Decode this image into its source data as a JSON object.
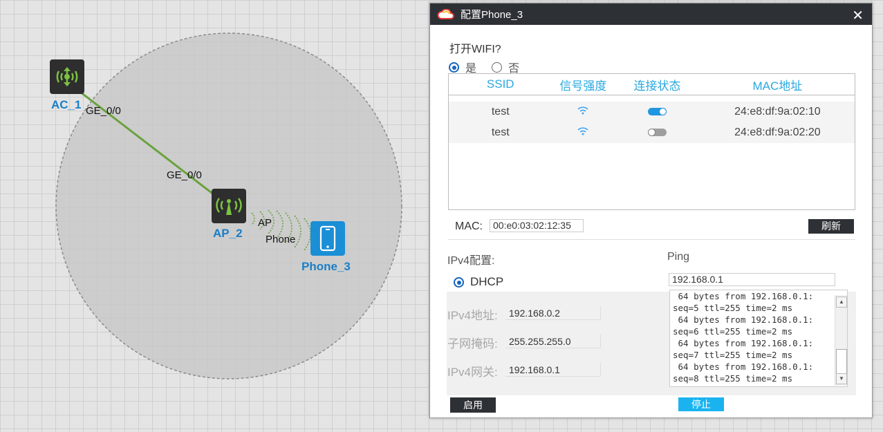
{
  "topology": {
    "nodes": [
      {
        "name": "AC_1",
        "icon": "access-controller-icon"
      },
      {
        "name": "AP_2",
        "icon": "access-point-icon"
      },
      {
        "name": "Phone_3",
        "icon": "phone-icon"
      }
    ],
    "link_labels": {
      "ac_port": "GE_0/0",
      "ap_port": "GE_0/0",
      "wifi_ap": "AP",
      "wifi_phone": "Phone"
    },
    "colors": {
      "link": "#6aa23c",
      "node_label": "#1a7fc7",
      "coverage": "#c8c8c8"
    }
  },
  "dialog": {
    "title": "配置Phone_3",
    "close": "✕",
    "wifi_question": "打开WIFI?",
    "wifi_yes": "是",
    "wifi_no": "否",
    "wifi_selected": "是",
    "table": {
      "headers": [
        "SSID",
        "信号强度",
        "连接状态",
        "MAC地址"
      ],
      "rows": [
        {
          "ssid": "test",
          "signal": "wifi-signal-icon",
          "connected": true,
          "mac": "24:e8:df:9a:02:10"
        },
        {
          "ssid": "test",
          "signal": "wifi-signal-icon",
          "connected": false,
          "mac": "24:e8:df:9a:02:20"
        }
      ]
    },
    "mac_label": "MAC:",
    "mac_value": "00:e0:03:02:12:35",
    "refresh_button": "刷新",
    "ipv4": {
      "section_label": "IPv4配置:",
      "dhcp_label": "DHCP",
      "address_label": "IPv4地址:",
      "address_value": "192.168.0.2",
      "mask_label": "子网掩码:",
      "mask_value": "255.255.255.0",
      "gateway_label": "IPv4网关:",
      "gateway_value": "192.168.0.1",
      "enable_button": "启用"
    },
    "ping": {
      "section_label": "Ping",
      "target_value": "192.168.0.1",
      "output": " 64 bytes from 192.168.0.1:\nseq=5 ttl=255 time=2 ms\n 64 bytes from 192.168.0.1:\nseq=6 ttl=255 time=2 ms\n 64 bytes from 192.168.0.1:\nseq=7 ttl=255 time=2 ms\n 64 bytes from 192.168.0.1:\nseq=8 ttl=255 time=2 ms",
      "stop_button": "停止"
    },
    "colors": {
      "titlebar": "#2d3035",
      "accent": "#29a8e0",
      "stop_button": "#1ab3f0"
    }
  }
}
